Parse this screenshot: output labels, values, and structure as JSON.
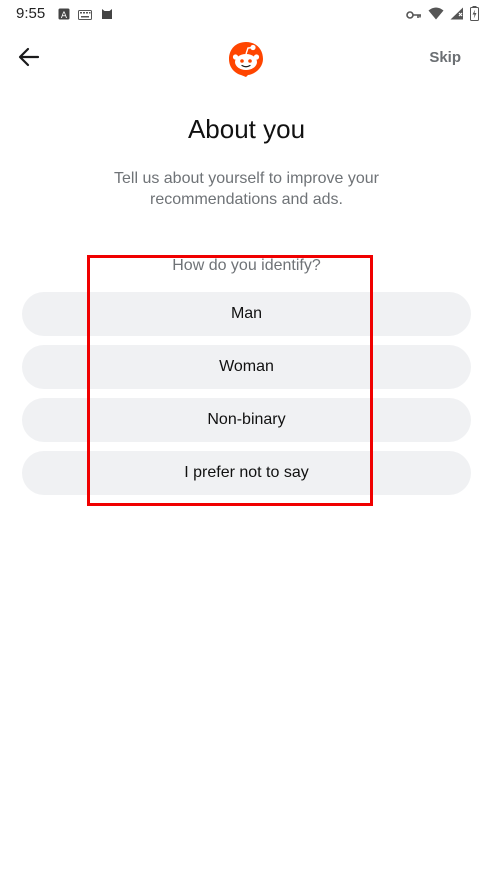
{
  "status_bar": {
    "time": "9:55",
    "left_icons": [
      "font-a-icon",
      "keyboard-icon",
      "cat-icon"
    ],
    "right_icons": [
      "key-icon",
      "wifi-icon",
      "signal-icon",
      "battery-charging-icon"
    ]
  },
  "header": {
    "back_icon": "arrow-left-icon",
    "logo": "reddit-logo-icon",
    "skip_label": "Skip"
  },
  "page": {
    "title": "About you",
    "subtitle": "Tell us about yourself to improve your recommendations and ads.",
    "question": "How do you identify?"
  },
  "options": [
    {
      "label": "Man"
    },
    {
      "label": "Woman"
    },
    {
      "label": "Non-binary"
    },
    {
      "label": "I prefer not to say"
    }
  ],
  "colors": {
    "accent": "#ff4500",
    "option_bg": "#f0f1f3",
    "highlight": "#f00000"
  }
}
